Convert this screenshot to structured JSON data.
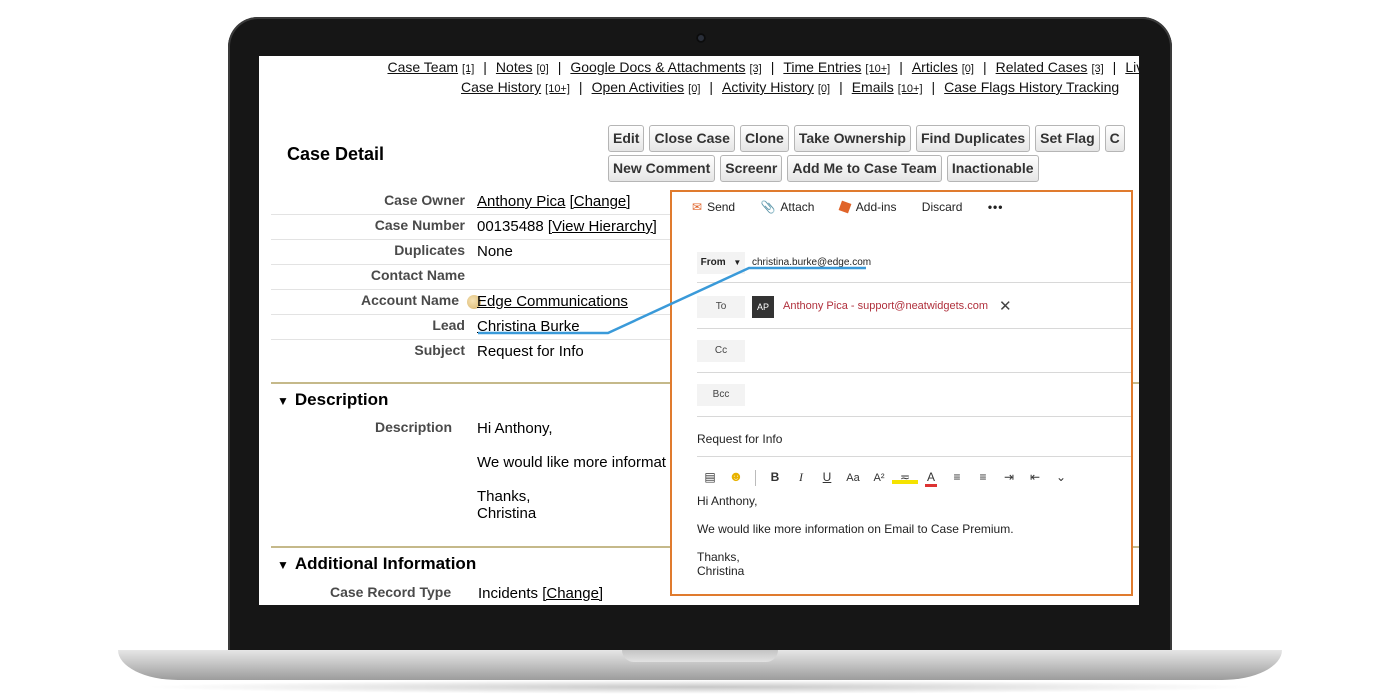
{
  "links": {
    "row1": [
      {
        "label": "Case Team",
        "count": "[1]"
      },
      {
        "label": "Notes",
        "count": "[0]"
      },
      {
        "label": "Google Docs & Attachments",
        "count": "[3]"
      },
      {
        "label": "Time Entries",
        "count": "[10+]"
      },
      {
        "label": "Articles",
        "count": "[0]"
      },
      {
        "label": "Related Cases",
        "count": "[3]"
      },
      {
        "label": "Live",
        "count": ""
      }
    ],
    "row2": [
      {
        "label": "Case History",
        "count": "[10+]"
      },
      {
        "label": "Open Activities",
        "count": "[0]"
      },
      {
        "label": "Activity History",
        "count": "[0]"
      },
      {
        "label": "Emails",
        "count": "[10+]"
      },
      {
        "label": "Case Flags History Tracking",
        "count": "["
      }
    ],
    "separator": "|"
  },
  "page_title": "Case Detail",
  "buttons": {
    "row1": [
      "Edit",
      "Close Case",
      "Clone",
      "Take Ownership",
      "Find Duplicates",
      "Set Flag",
      "C"
    ],
    "row2": [
      "New Comment",
      "Screenr",
      "Add Me to Case Team",
      "Inactionable"
    ]
  },
  "fields": {
    "case_owner": {
      "label": "Case Owner",
      "value": "Anthony Pica",
      "action": "[Change]"
    },
    "case_number": {
      "label": "Case Number",
      "value": "00135488",
      "action": "[View Hierarchy]"
    },
    "duplicates": {
      "label": "Duplicates",
      "value": "None"
    },
    "contact_name": {
      "label": "Contact Name",
      "value": ""
    },
    "account_name": {
      "label": "Account Name",
      "value": "Edge Communications"
    },
    "lead": {
      "label": "Lead",
      "value": "Christina Burke"
    },
    "subject": {
      "label": "Subject",
      "value": "Request for Info"
    }
  },
  "description_section": {
    "title": "Description",
    "label": "Description",
    "text": "Hi Anthony,\n\nWe would like more informat\n\nThanks,\nChristina"
  },
  "additional_section": {
    "title": "Additional Information",
    "record_type_label": "Case Record Type",
    "record_type_value": "Incidents",
    "record_type_action": "[Change]"
  },
  "email": {
    "toolbar": {
      "send": "Send",
      "attach": "Attach",
      "addins": "Add-ins",
      "discard": "Discard",
      "more": "•••"
    },
    "from_label": "From",
    "from_value": "christina.burke@edge.com",
    "to_label": "To",
    "to_initials": "AP",
    "to_recipient": "Anthony Pica - support@neatwidgets.com",
    "cc_label": "Cc",
    "bcc_label": "Bcc",
    "subject": "Request for Info",
    "body": "Hi Anthony,\n\nWe would like more information on Email to Case Premium.\n\nThanks,\nChristina",
    "accent_color": "#e07b2e"
  },
  "connector_color": "#3a9ad9"
}
